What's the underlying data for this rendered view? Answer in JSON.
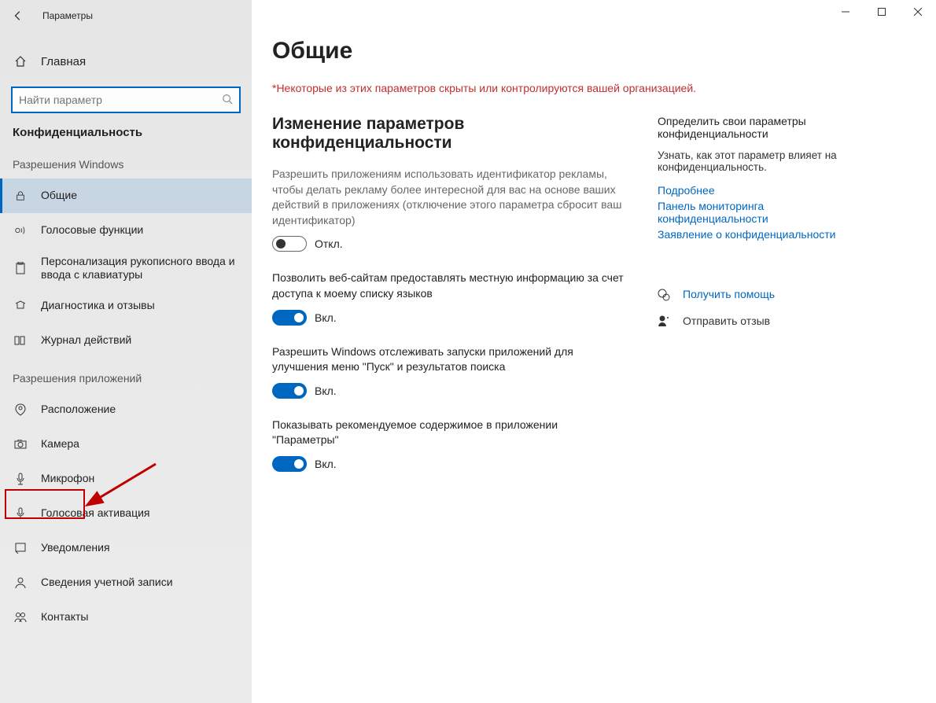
{
  "window": {
    "title": "Параметры"
  },
  "sidebar": {
    "home": "Главная",
    "search_placeholder": "Найти параметр",
    "category": "Конфиденциальность",
    "group1_label": "Разрешения Windows",
    "group1": [
      {
        "label": "Общие",
        "selected": true
      },
      {
        "label": "Голосовые функции"
      },
      {
        "label": "Персонализация рукописного ввода и ввода с клавиатуры"
      },
      {
        "label": "Диагностика и отзывы"
      },
      {
        "label": "Журнал действий"
      }
    ],
    "group2_label": "Разрешения приложений",
    "group2": [
      {
        "label": "Расположение"
      },
      {
        "label": "Камера",
        "highlighted": true
      },
      {
        "label": "Микрофон"
      },
      {
        "label": "Голосовая активация"
      },
      {
        "label": "Уведомления"
      },
      {
        "label": "Сведения учетной записи"
      },
      {
        "label": "Контакты"
      }
    ]
  },
  "main": {
    "title": "Общие",
    "warning": "*Некоторые из этих параметров скрыты или контролируются вашей организацией.",
    "section_title": "Изменение параметров конфиденциальности",
    "settings": [
      {
        "desc": "Разрешить приложениям использовать идентификатор рекламы, чтобы делать рекламу более интересной для вас на основе ваших действий в приложениях (отключение этого параметра сбросит ваш идентификатор)",
        "state_label": "Откл.",
        "on": false,
        "muted": true
      },
      {
        "desc": "Позволить веб-сайтам предоставлять местную информацию за счет доступа к моему списку языков",
        "state_label": "Вкл.",
        "on": true
      },
      {
        "desc": "Разрешить Windows отслеживать запуски приложений для улучшения меню \"Пуск\" и результатов поиска",
        "state_label": "Вкл.",
        "on": true
      },
      {
        "desc": "Показывать рекомендуемое содержимое в приложении \"Параметры\"",
        "state_label": "Вкл.",
        "on": true
      }
    ]
  },
  "right": {
    "title": "Определить свои параметры конфиденциальности",
    "desc": "Узнать, как этот параметр влияет на конфиденциальность.",
    "links": [
      "Подробнее",
      "Панель мониторинга конфиденциальности",
      "Заявление о конфиденциальности"
    ],
    "help": "Получить помощь",
    "feedback": "Отправить отзыв"
  }
}
